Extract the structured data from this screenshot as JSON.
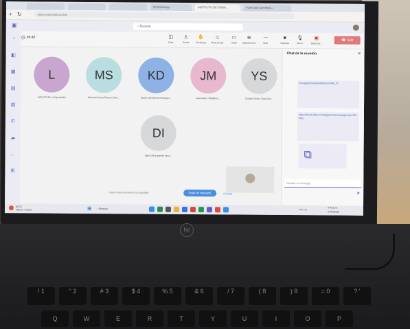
{
  "browser": {
    "tabs": [
      "",
      "",
      "",
      "(9) WhatsApp",
      "INSTITUTO DE FORM...",
      "PLAN DE CONTROL..."
    ],
    "address": "teams.microsoft.com/v2/"
  },
  "teams": {
    "search_placeholder": "Buscar",
    "rail": [
      "",
      "",
      "",
      "",
      "",
      "",
      "",
      "",
      ""
    ],
    "timer": "56:40",
    "toolbar": [
      {
        "label": "Chat",
        "icon": "chat-icon"
      },
      {
        "label": "Gente",
        "icon": "people-icon"
      },
      {
        "label": "Participar",
        "icon": "hand-icon"
      },
      {
        "label": "Reaccionar",
        "icon": "smile-icon"
      },
      {
        "label": "Vista",
        "icon": "view-icon"
      },
      {
        "label": "Aplicaciones",
        "icon": "apps-icon"
      },
      {
        "label": "Más",
        "icon": "more-icon"
      },
      {
        "label": "Cámara",
        "icon": "camera-icon"
      },
      {
        "label": "Micro",
        "icon": "mic-icon"
      },
      {
        "label": "Dejar de...",
        "icon": "share-stop-icon"
      }
    ],
    "leave_label": "Salir"
  },
  "participants": [
    {
      "initials": "L",
      "name": "Jefsonl? (No comprobado)",
      "color": "#c9a6cf"
    },
    {
      "initials": "MS",
      "name": "Marisoft Paula Ramos Silva...",
      "color": "#b9dde0"
    },
    {
      "initials": "KD",
      "name": "Karen Daniela Montenegro...",
      "color": "#8eb2e6"
    },
    {
      "initials": "JM",
      "name": "Jose Mario Villalobos...",
      "color": "#e8b9ce"
    },
    {
      "initials": "YS",
      "name": "Yuanari Greco Sosa Sra...",
      "color": "#d6d8da"
    },
    {
      "initials": "DI",
      "name": "diana ultra grande sip d...",
      "color": "#d6d8da"
    }
  ],
  "share": {
    "text": "Usted está presentando una pantalla",
    "stop_label": "Dejar de compartir",
    "link": "Ocultar"
  },
  "chat": {
    "title": "Chat de la reunión",
    "messages": [
      "/Google/Drive/My%20Files?i=/file_h?",
      "https://forms.office.com/pages/responsepage.aspx?id=DQs"
    ],
    "input_placeholder": "Escribir un mensaje"
  },
  "taskbar": {
    "weather": "20°C",
    "weather_sub": "Mayorm. nublado",
    "search": "Buscar",
    "lang": "ESP LAA",
    "time": "4:40 p.m.",
    "date": "24/04/2024"
  },
  "laptop": {
    "brand": "hp"
  },
  "keyboard": {
    "row1": [
      "!",
      "\"",
      "#",
      "$",
      "%",
      "&",
      "/",
      "(",
      ")",
      "=",
      "?"
    ],
    "row1_sub": [
      "1",
      "2",
      "3",
      "4",
      "5",
      "6",
      "7",
      "8",
      "9",
      "0",
      "'"
    ],
    "row2": [
      "Q",
      "W",
      "E",
      "R",
      "T",
      "Y",
      "U",
      "I",
      "O",
      "P"
    ]
  }
}
